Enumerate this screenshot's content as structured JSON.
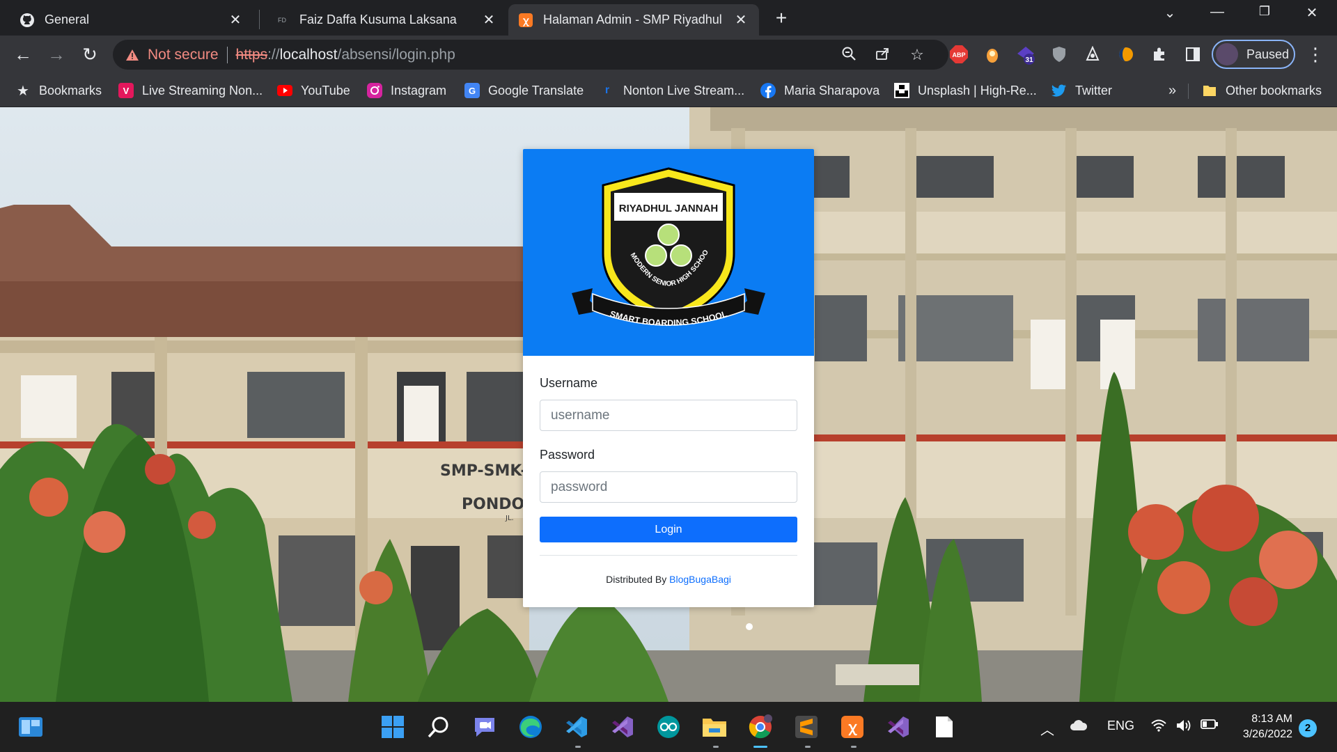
{
  "browser": {
    "tabs": [
      {
        "title": "General",
        "favicon": "github-icon"
      },
      {
        "title": "Faiz Daffa Kusuma Laksana",
        "favicon": "fd-icon"
      },
      {
        "title": "Halaman Admin - SMP Riyadhul",
        "favicon": "xampp-icon",
        "active": true
      }
    ],
    "new_tab_label": "+",
    "address": {
      "warning_text": "Not secure",
      "scheme": "https",
      "sep": "://",
      "host": "localhost",
      "path": "/absensi/login.php"
    },
    "extensions": [
      "abp-icon",
      "honey-icon",
      "calendar-icon",
      "shield-icon",
      "spy-icon",
      "firefly-icon",
      "puzzle-icon",
      "sidepanel-icon"
    ],
    "extension_badge": "31",
    "abp_label": "ABP",
    "profile_label": "Paused"
  },
  "bookmarks": {
    "all_label": "Bookmarks",
    "items": [
      {
        "label": "Live Streaming Non...",
        "icon": "vidio-icon",
        "color": "#e4175c"
      },
      {
        "label": "YouTube",
        "icon": "youtube-icon",
        "color": "#ff0000"
      },
      {
        "label": "Instagram",
        "icon": "instagram-icon",
        "color": "#d6249f"
      },
      {
        "label": "Google Translate",
        "icon": "translate-icon",
        "color": "#4285f4"
      },
      {
        "label": "Nonton Live Stream...",
        "icon": "rcti-icon",
        "color": "#1a73e8"
      },
      {
        "label": "Maria Sharapova",
        "icon": "facebook-icon",
        "color": "#1877f2"
      },
      {
        "label": "Unsplash | High-Re...",
        "icon": "unsplash-icon",
        "color": "#ffffff"
      },
      {
        "label": "Twitter",
        "icon": "twitter-icon",
        "color": "#1d9bf0"
      }
    ],
    "overflow_label": "»",
    "other_label": "Other bookmarks"
  },
  "login": {
    "logo": {
      "top_text": "RIYADHUL JANNAH",
      "arc_text": "MODERN SENIOR HIGH SCHOOL",
      "ribbon_text": "SMART BOARDING SCHOOL"
    },
    "username_label": "Username",
    "username_placeholder": "username",
    "password_label": "Password",
    "password_placeholder": "password",
    "submit_label": "Login",
    "footer_prefix": "Distributed By ",
    "footer_link": "BlogBugaBagi",
    "header_color": "#0b7cf3",
    "button_color": "#0d6efd"
  },
  "background_sign": {
    "line1": "SMP-SMK-",
    "line2": "PONDOK",
    "line3": "JL."
  },
  "taskbar": {
    "apps": [
      "start-icon",
      "search-icon",
      "chat-icon",
      "edge-icon",
      "vscode-icon",
      "visual-studio-icon",
      "arduino-icon",
      "file-explorer-icon",
      "chrome-icon",
      "sublime-icon",
      "xampp-icon",
      "visual-studio-2-icon",
      "notepad-icon"
    ],
    "language": "ENG",
    "time": "8:13 AM",
    "date": "3/26/2022",
    "notifications": "2"
  }
}
